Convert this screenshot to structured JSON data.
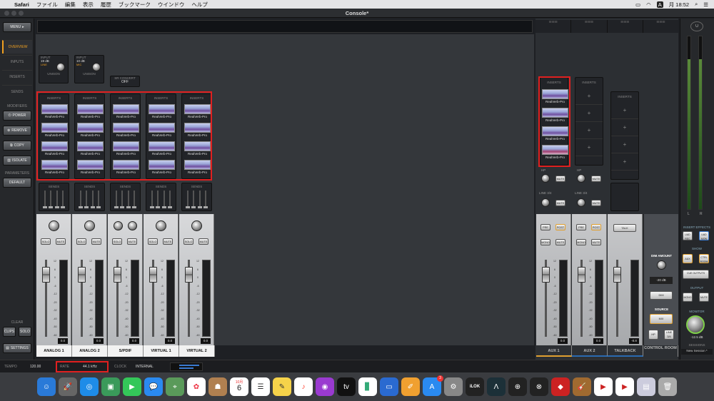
{
  "menubar": {
    "app": "Safari",
    "items": [
      "ファイル",
      "編集",
      "表示",
      "履歴",
      "ブックマーク",
      "ウインドウ",
      "ヘルプ"
    ],
    "clock": "月 18:52",
    "input_indicator": "A"
  },
  "window": {
    "title": "Console*"
  },
  "nav": {
    "menu_label": "MENU",
    "tabs": [
      "OVERVIEW",
      "INPUTS",
      "INSERTS",
      "SENDS"
    ],
    "modifiers_label": "MODIFIERS",
    "modifier_buttons": [
      "POWER",
      "REMOVE",
      "COPY",
      "ISOLATE"
    ],
    "parameters_label": "PARAMETERS",
    "default_label": "DEFAULT",
    "clear_label": "CLEAR",
    "clips_label": "CLIPS",
    "solo_label": "SOLO",
    "settings_label": "SETTINGS"
  },
  "preamps": [
    {
      "label": "INPUT",
      "gain": "19 dB",
      "type": "LINE",
      "unison": "UNISON"
    },
    {
      "label": "INPUT",
      "gain": "10 dB",
      "type": "MIC",
      "unison": "UNISON"
    }
  ],
  "sr_convert": {
    "label": "SR CONVERT",
    "value": "OFF"
  },
  "inserts_label": "INSERTS",
  "sends_label": "SENDS",
  "plugin_name": "RealVerb-Pro",
  "channels": [
    {
      "name": "ANALOG 1",
      "level": "0.0"
    },
    {
      "name": "ANALOG 2",
      "level": "0.0"
    },
    {
      "name": "S/PDIF",
      "level": "0.0"
    },
    {
      "name": "VIRTUAL 1",
      "level": "0.0"
    },
    {
      "name": "VIRTUAL 2",
      "level": "0.0"
    }
  ],
  "fader_scale": [
    "12",
    "6",
    "0",
    "-6",
    "-12",
    "-20",
    "-32",
    "-40",
    "-50",
    "-60"
  ],
  "button_labels": {
    "solo": "SOLO",
    "mute": "MUTE",
    "pre": "PRE",
    "post": "POST",
    "mono": "MONO",
    "talk": "TALK"
  },
  "aux": [
    {
      "name": "AUX 1",
      "level": "0.0"
    },
    {
      "name": "AUX 2",
      "level": "0.0"
    }
  ],
  "hp_label": "HP",
  "line34_label": "LINE 3/4",
  "talkback": {
    "name": "TALKBACK",
    "level": "-8.8"
  },
  "control_room": {
    "name": "CONTROL ROOM",
    "dim_amount_label": "DIM AMOUNT",
    "dim_value": "-20 dB",
    "dim_button": "DIM",
    "source_label": "SOURCE",
    "source_value": "MIX",
    "hp_label": "HP",
    "line34_label": "LINE 3/4"
  },
  "right_panel": {
    "insert_effects": "INSERT EFFECTS",
    "uad_rec": "UAD REC",
    "uad_mon": "UAD MON",
    "show": "SHOW",
    "aux": "AUX",
    "ctrl_room": "CTRL ROOM",
    "cue_outputs": "CUE OUTPUTS",
    "output": "OUTPUT",
    "mono": "MONO",
    "mute": "MUTE",
    "monitor": "MONITOR",
    "monitor_value": "-12.5 dB",
    "sessions": "SESSIONS",
    "session_name": "New Session *",
    "meter_l": "L",
    "meter_r": "R"
  },
  "status": {
    "tempo_label": "TEMPO",
    "tempo": "120.00",
    "rate_label": "RATE",
    "rate": "44.1 kHz",
    "clock_label": "CLOCK",
    "clock": "INTERNAL"
  },
  "dock": {
    "calendar_month": "10月",
    "calendar_day": "6",
    "appstore_badge": "3",
    "ilok_label": "iLOK"
  }
}
